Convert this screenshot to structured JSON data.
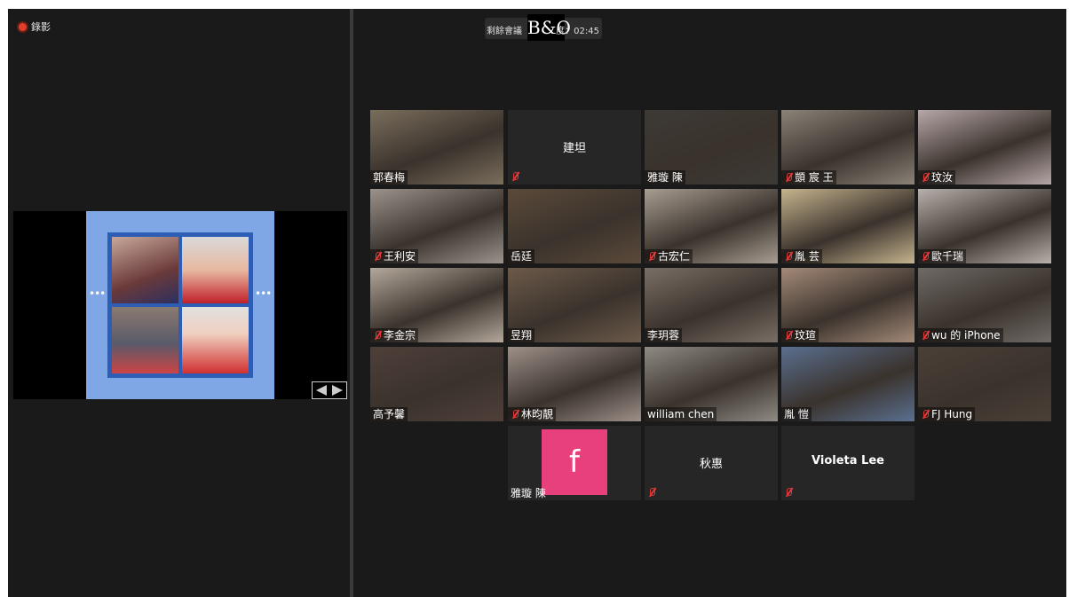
{
  "recording": {
    "label": "錄影"
  },
  "meeting": {
    "remaining_label": "剩餘會議",
    "time_label": "度：02:45",
    "logo_text": "B&O"
  },
  "share": {
    "nav_label": "prev-next"
  },
  "colors": {
    "bg": "#1a1a1a",
    "tile": "#262626",
    "active": "#e6e64a",
    "mute": "#e23a3a",
    "facebook": "#e8407c"
  },
  "participants": [
    {
      "name": "郭春梅",
      "muted": false,
      "video": true,
      "tone": "#7a6e5c"
    },
    {
      "name": "建坦",
      "muted": true,
      "video": false
    },
    {
      "name": "雅璇 陳",
      "muted": false,
      "video": true,
      "tone": "#3d3a36"
    },
    {
      "name": "顗 宸 王",
      "muted": true,
      "video": true,
      "tone": "#8b8278"
    },
    {
      "name": "玟汝",
      "muted": true,
      "video": true,
      "tone": "#b7a7a8"
    },
    {
      "name": "王利安",
      "muted": true,
      "video": true,
      "tone": "#9b938c"
    },
    {
      "name": "岳廷",
      "muted": false,
      "video": true,
      "tone": "#5b4a3a"
    },
    {
      "name": "古宏仁",
      "muted": true,
      "video": true,
      "tone": "#a89e92"
    },
    {
      "name": "胤 芸",
      "muted": true,
      "video": true,
      "tone": "#c6b48e"
    },
    {
      "name": "歐千瑞",
      "muted": true,
      "video": true,
      "tone": "#b8b0ab"
    },
    {
      "name": "李金宗",
      "muted": true,
      "video": true,
      "tone": "#b4a89b"
    },
    {
      "name": "昱翔",
      "muted": false,
      "video": true,
      "tone": "#6c5a4a"
    },
    {
      "name": "李玥蓉",
      "muted": false,
      "video": true,
      "tone": "#7a6f66"
    },
    {
      "name": "玟瑄",
      "muted": true,
      "video": true,
      "tone": "#a48a78"
    },
    {
      "name": "wu 的 iPhone",
      "muted": true,
      "video": true,
      "tone": "#6f6a66"
    },
    {
      "name": "高予馨",
      "muted": false,
      "video": true,
      "tone": "#4f3f39"
    },
    {
      "name": "林昀靚",
      "muted": true,
      "video": true,
      "tone": "#9d9089"
    },
    {
      "name": "william chen",
      "muted": false,
      "video": true,
      "tone": "#8f8a84",
      "active": true
    },
    {
      "name": "胤 愷",
      "muted": false,
      "video": true,
      "tone": "#5a6f8f"
    },
    {
      "name": "FJ Hung",
      "muted": true,
      "video": true,
      "tone": "#4b4038"
    },
    {
      "name": "雅璇 陳",
      "muted": false,
      "video": false,
      "facebook": "f"
    },
    {
      "name": "秋惠",
      "muted": true,
      "video": false
    },
    {
      "name": "Violeta Lee",
      "muted": true,
      "video": false
    }
  ]
}
